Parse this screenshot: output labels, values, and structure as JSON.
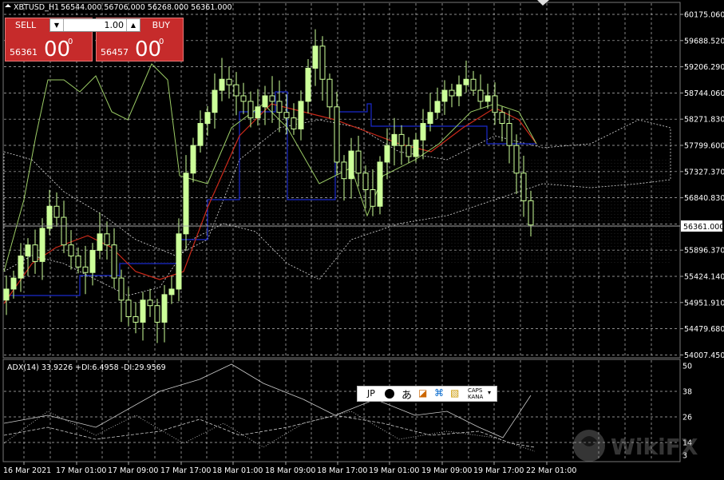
{
  "header": {
    "symbol_timeframe": "XBTUSD_H1",
    "ohlc": "56544.000 56706.000 56268.000 56361.000"
  },
  "trade_panel": {
    "sell_label": "SELL",
    "buy_label": "BUY",
    "lot_value": "1.00",
    "lot_down_icon": "triangle-down",
    "lot_up_icon": "triangle-up",
    "sell_price_prefix": "56361",
    "sell_price_big": "00",
    "sell_price_sup": "0",
    "buy_price_prefix": "56457",
    "buy_price_big": "00",
    "buy_price_sup": "0"
  },
  "price_axis": {
    "labels": [
      "60175.060",
      "59688.520",
      "59206.290",
      "58744.060",
      "58271.830",
      "57799.600",
      "57327.370",
      "56840.830",
      "56361.000",
      "55896.370",
      "55424.140",
      "54951.910",
      "54479.680",
      "54007.450"
    ],
    "current_price": "56361.000",
    "current_price_value": 56361.0
  },
  "indicator": {
    "label": "ADX(14) 33.9226 +DI:6.4958 -DI:29.9569",
    "axis_labels": [
      "50",
      "38",
      "26",
      "14",
      "3"
    ]
  },
  "time_axis": {
    "labels": [
      "16 Mar 2021",
      "17 Mar 01:00",
      "17 Mar 09:00",
      "17 Mar 17:00",
      "18 Mar 01:00",
      "18 Mar 09:00",
      "18 Mar 17:00",
      "19 Mar 01:00",
      "19 Mar 09:00",
      "19 Mar 17:00",
      "22 Mar 01:00"
    ]
  },
  "ime_toolbar": {
    "mode": "JP",
    "hiragana": "あ",
    "caps": "CAPS",
    "kana": "KANA"
  },
  "colors": {
    "background": "#000000",
    "grid": "#c8c8c8",
    "candle": "#ccff99",
    "blue_line": "#1a2acc",
    "red_line": "#cc2a1a",
    "sell_buy_bg": "#c62b2b"
  },
  "watermark": "WikiFX"
}
